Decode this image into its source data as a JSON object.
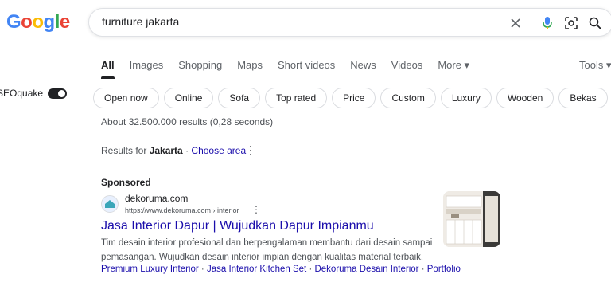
{
  "logo": {
    "letters": [
      "G",
      "o",
      "o",
      "g",
      "l",
      "e"
    ]
  },
  "search": {
    "query": "furniture jakarta"
  },
  "tabs": [
    {
      "label": "All",
      "active": true
    },
    {
      "label": "Images"
    },
    {
      "label": "Shopping"
    },
    {
      "label": "Maps"
    },
    {
      "label": "Short videos"
    },
    {
      "label": "News"
    },
    {
      "label": "Videos"
    },
    {
      "label": "More ▾"
    }
  ],
  "tools_label": "Tools ▾",
  "seoquake": {
    "label": "SEOquake"
  },
  "chips": [
    "Open now",
    "Online",
    "Sofa",
    "Top rated",
    "Price",
    "Custom",
    "Luxury",
    "Wooden",
    "Bekas"
  ],
  "stats": "About 32.500.000 results (0,28 seconds)",
  "location": {
    "prefix": "Results for ",
    "place": "Jakarta",
    "separator": " · ",
    "link": "Choose area"
  },
  "ad": {
    "sponsored_label": "Sponsored",
    "site_name": "dekoruma.com",
    "url": "https://www.dekoruma.com › interior",
    "title": "Jasa Interior Dapur | Wujudkan Dapur Impianmu",
    "description": "Tim desain interior profesional dan berpengalaman membantu dari desain sampai pemasangan. Wujudkan desain interior impian dengan kualitas material terbaik.",
    "sitelinks": [
      "Premium Luxury Interior",
      "Jasa Interior Kitchen Set",
      "Dekoruma Desain Interior",
      "Portfolio"
    ]
  },
  "colors": {
    "link": "#1a0dab",
    "text": "#202124",
    "muted": "#4d5156"
  }
}
